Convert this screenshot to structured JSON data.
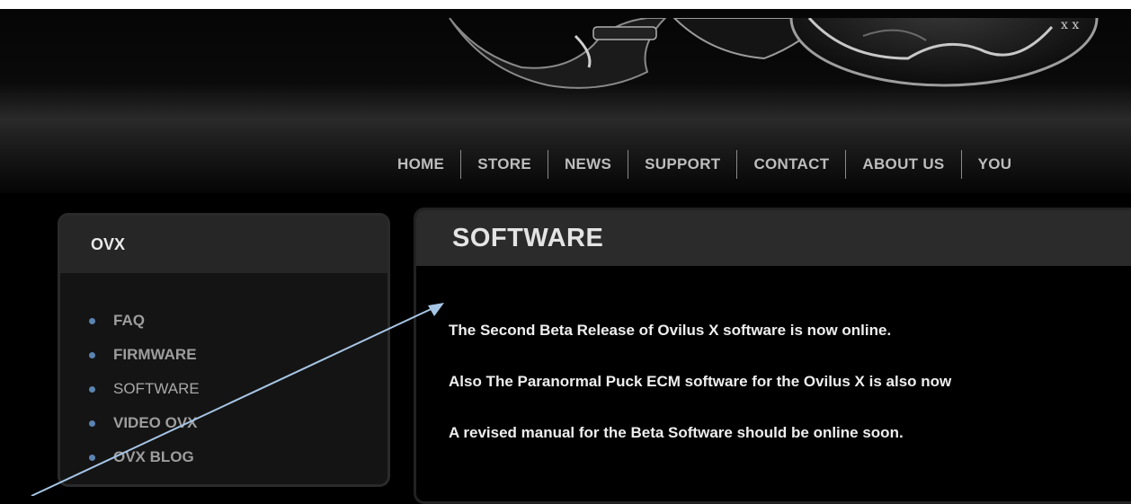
{
  "nav": {
    "items": [
      "HOME",
      "STORE",
      "NEWS",
      "SUPPORT",
      "CONTACT",
      "ABOUT US",
      "YOU"
    ]
  },
  "sidebar": {
    "title": "OVX",
    "items": [
      {
        "label": "FAQ"
      },
      {
        "label": "FIRMWARE"
      },
      {
        "label": "SOFTWARE"
      },
      {
        "label": "VIDEO OVX"
      },
      {
        "label": "OVX BLOG"
      }
    ]
  },
  "main": {
    "title": "SOFTWARE",
    "paragraphs": [
      "The Second Beta Release of Ovilus X software is now online.",
      "Also The Paranormal Puck ECM software for the Ovilus X is also now",
      "A revised manual for the Beta Software should be online soon."
    ]
  },
  "colors": {
    "bullet": "#5b84b1",
    "annotation_arrow": "#a7c6e6"
  }
}
